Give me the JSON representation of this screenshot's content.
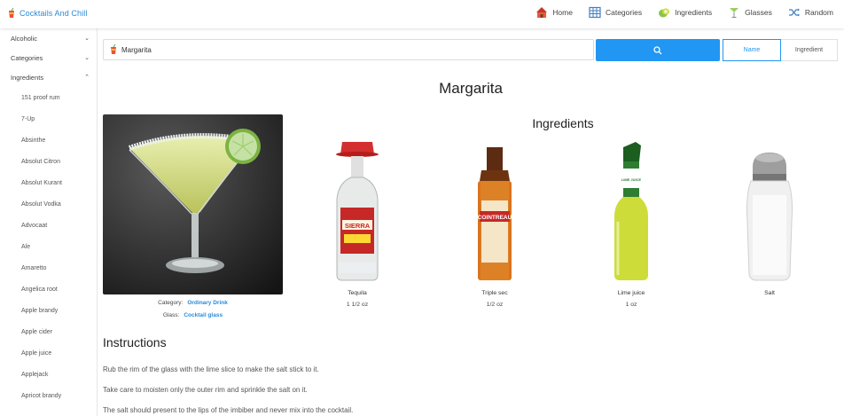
{
  "app": {
    "title": "Cocktails And Chill"
  },
  "nav": [
    {
      "label": "Home",
      "icon": "house-icon"
    },
    {
      "label": "Categories",
      "icon": "grid-icon"
    },
    {
      "label": "Ingredients",
      "icon": "lime-icon"
    },
    {
      "label": "Glasses",
      "icon": "martini-glass-icon"
    },
    {
      "label": "Random",
      "icon": "shuffle-icon"
    }
  ],
  "sidebar": {
    "sections": [
      {
        "label": "Alcoholic",
        "expanded": false
      },
      {
        "label": "Categories",
        "expanded": false
      },
      {
        "label": "Ingredients",
        "expanded": true
      }
    ],
    "ingredients": [
      "151 proof rum",
      "7-Up",
      "Absinthe",
      "Absolut Citron",
      "Absolut Kurant",
      "Absolut Vodka",
      "Advocaat",
      "Ale",
      "Amaretto",
      "Angelica root",
      "Apple brandy",
      "Apple cider",
      "Apple juice",
      "Applejack",
      "Apricot brandy"
    ]
  },
  "search": {
    "value": "Margarita",
    "mode_name": "Name",
    "mode_ingredient": "Ingredient",
    "active_mode": "Name"
  },
  "drink": {
    "name": "Margarita",
    "category_label": "Category:",
    "category": "Ordinary Drink",
    "glass_label": "Glass:",
    "glass": "Cocktail glass",
    "ingredients_heading": "Ingredients",
    "ingredients": [
      {
        "name": "Tequila",
        "measure": "1 1/2 oz"
      },
      {
        "name": "Triple sec",
        "measure": "1/2 oz"
      },
      {
        "name": "Lime juice",
        "measure": "1 oz"
      },
      {
        "name": "Salt",
        "measure": ""
      }
    ],
    "bottle_labels": {
      "tequila": "SIERRA",
      "triple_sec": "COINTREAU",
      "lime_juice": "LIME JUICE"
    },
    "instructions_heading": "Instructions",
    "instructions": [
      "Rub the rim of the glass with the lime slice to make the salt stick to it.",
      "Take care to moisten only the outer rim and sprinkle the salt on it.",
      "The salt should present to the lips of the imbiber and never mix into the cocktail."
    ]
  },
  "colors": {
    "accent": "#2196f3",
    "link": "#2a8bd8",
    "divider": "#e6e6e6"
  }
}
